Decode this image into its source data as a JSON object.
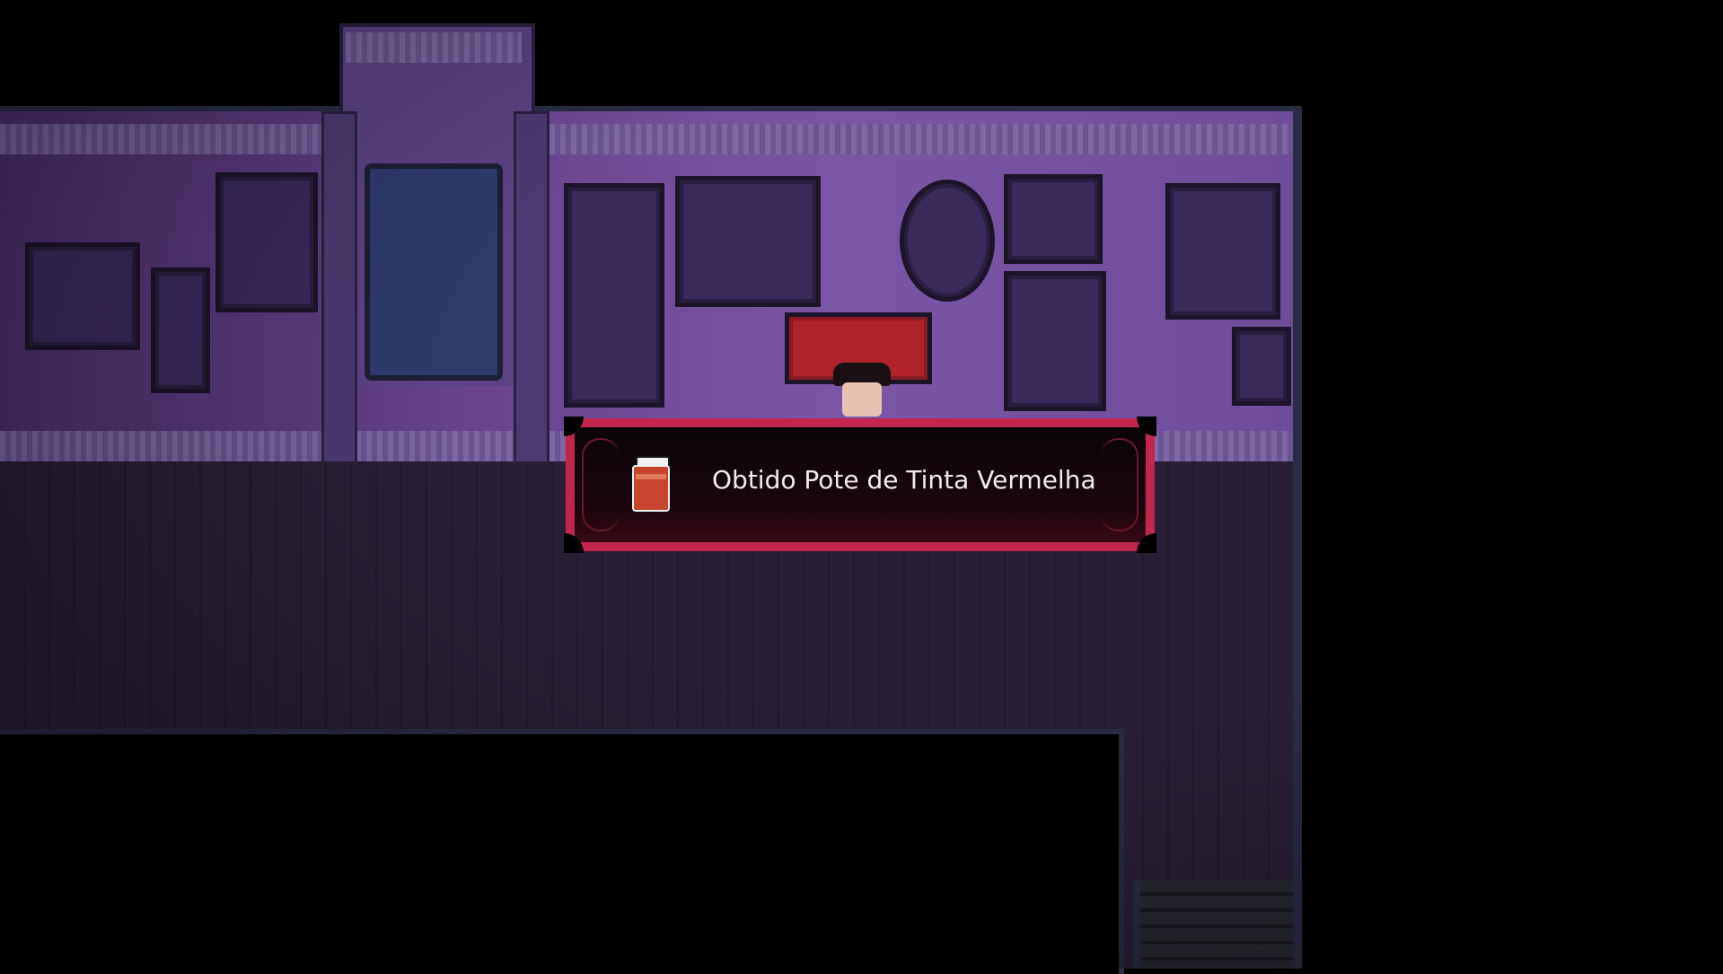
{
  "notification": {
    "icon": "red-paint-jar-icon",
    "message": "Obtido Pote de Tinta Vermelha",
    "border_color": "#c2264c"
  },
  "colors": {
    "wall": "#6a4690",
    "floor": "#2a2036",
    "door": "#2e3a6c"
  }
}
